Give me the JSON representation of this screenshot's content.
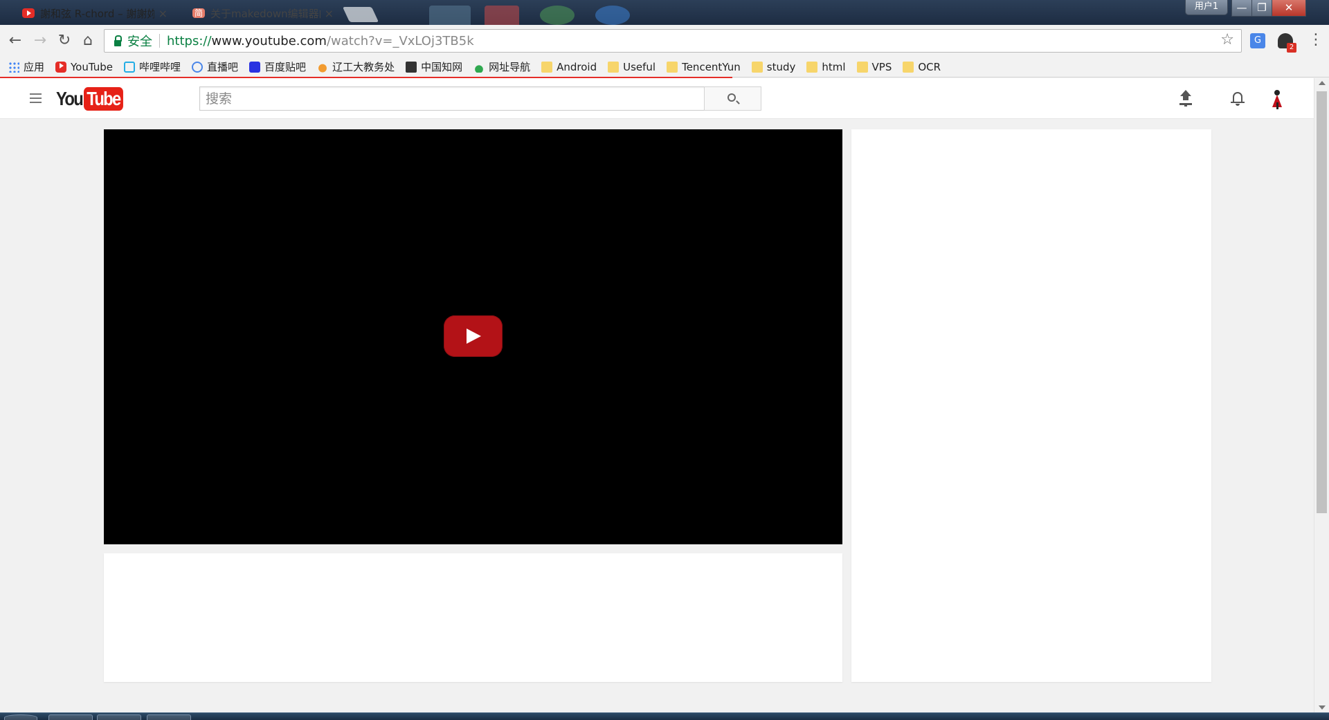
{
  "browser": {
    "tabs": [
      {
        "title": "謝和弦 R-chord – 謝謝妳",
        "favicon": "youtube-icon",
        "active": true,
        "close": "×"
      },
      {
        "title": "关于makedown编辑器的",
        "favicon": "jianshu-icon",
        "favicon_text": "简",
        "active": false,
        "close": "×"
      }
    ],
    "user_badge": "用户1",
    "window_buttons": {
      "minimize": "—",
      "restore": "❐",
      "close": "✕"
    },
    "nav": {
      "back": "←",
      "forward": "→",
      "reload": "↻",
      "home": "⌂"
    },
    "omnibox": {
      "security_label": "安全",
      "url_scheme": "https://",
      "url_host": "www.youtube.com",
      "url_path": "/watch?v=_VxLOj3TB5k",
      "star": "☆"
    },
    "extensions": {
      "translate_text": "G",
      "badge_count": "2"
    },
    "menu": "⋮",
    "bookmarks": [
      {
        "label": "应用",
        "icon": "apps-icon"
      },
      {
        "label": "YouTube",
        "icon": "youtube-icon"
      },
      {
        "label": "哔哩哔哩",
        "icon": "bilibili-icon"
      },
      {
        "label": "直播吧",
        "icon": "zhibo8-icon"
      },
      {
        "label": "百度贴吧",
        "icon": "baidu-icon"
      },
      {
        "label": "辽工大教务处",
        "icon": "lntu-icon"
      },
      {
        "label": "中国知网",
        "icon": "cnki-icon"
      },
      {
        "label": "网址导航",
        "icon": "2345-icon"
      },
      {
        "label": "Android",
        "icon": "folder-icon"
      },
      {
        "label": "Useful",
        "icon": "folder-icon"
      },
      {
        "label": "TencentYun",
        "icon": "folder-icon"
      },
      {
        "label": "study",
        "icon": "folder-icon"
      },
      {
        "label": "html",
        "icon": "folder-icon"
      },
      {
        "label": "VPS",
        "icon": "folder-icon"
      },
      {
        "label": "OCR",
        "icon": "folder-icon"
      }
    ]
  },
  "youtube": {
    "logo_you": "You",
    "logo_tube": "Tube",
    "search": {
      "placeholder": "搜索",
      "value": ""
    },
    "colors": {
      "brand_red": "#e62117",
      "play_button": "#b31217"
    },
    "player": {
      "state": "paused",
      "play_icon": "play-icon"
    }
  }
}
